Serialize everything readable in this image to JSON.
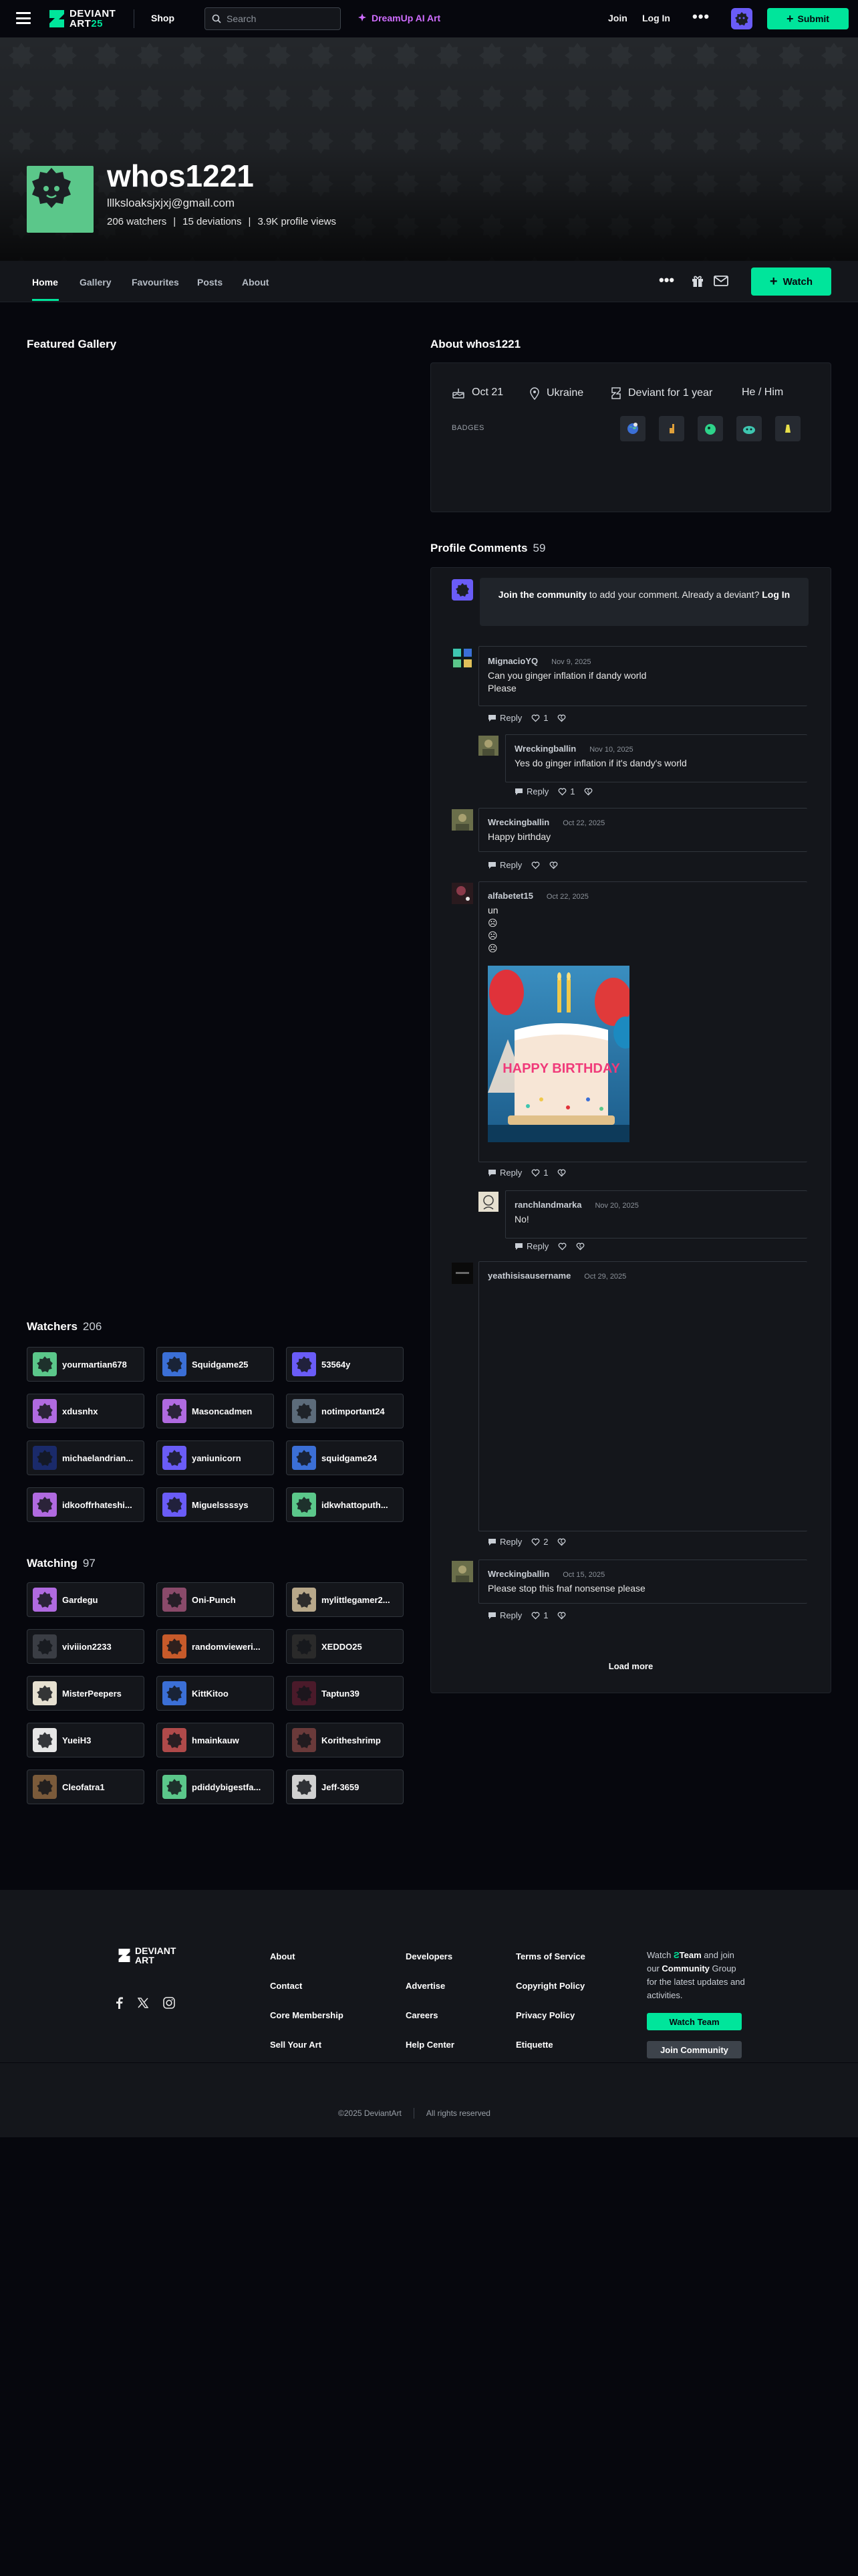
{
  "topbar": {
    "logo_line1": "DEVIANT",
    "logo_line2": "ART",
    "logo_suffix": "25",
    "shop": "Shop",
    "search_placeholder": "Search",
    "dreamup": "DreamUp AI Art",
    "join": "Join",
    "login": "Log In",
    "submit": "Submit"
  },
  "profile": {
    "username": "whos1221",
    "email": "lllksloaksjxjxj@gmail.com",
    "watchers": "206 watchers",
    "deviations": "15 deviations",
    "views": "3.9K profile views",
    "avatar_color": "#5bc78a"
  },
  "nav": {
    "tabs": [
      "Home",
      "Gallery",
      "Favourites",
      "Posts",
      "About"
    ],
    "watch": "Watch"
  },
  "featured": {
    "title": "Featured Gallery"
  },
  "watchers": {
    "title": "Watchers",
    "count": "206",
    "users": [
      {
        "name": "yourmartian678",
        "color": "#5bc78a"
      },
      {
        "name": "Squidgame25",
        "color": "#3b6fd6"
      },
      {
        "name": "53564y",
        "color": "#6a5cf7"
      },
      {
        "name": "xdusnhx",
        "color": "#b06ae0"
      },
      {
        "name": "Masoncadmen",
        "color": "#b06ae0"
      },
      {
        "name": "notimportant24",
        "color": "#5c6b7a"
      },
      {
        "name": "michaelandrian...",
        "color": "#1a2a6a"
      },
      {
        "name": "yaniunicorn",
        "color": "#6a5cf7"
      },
      {
        "name": "squidgame24",
        "color": "#3b6fd6"
      },
      {
        "name": "idkooffrhateshi...",
        "color": "#b06ae0"
      },
      {
        "name": "Miguelssssys",
        "color": "#6a5cf7"
      },
      {
        "name": "idkwhattoputh...",
        "color": "#5bc78a"
      }
    ]
  },
  "watching": {
    "title": "Watching",
    "count": "97",
    "users": [
      {
        "name": "Gardegu",
        "color": "#b06ae0"
      },
      {
        "name": "Oni-Punch",
        "color": "#8a4a6a"
      },
      {
        "name": "mylittlegamer2...",
        "color": "#b8a88a"
      },
      {
        "name": "viviiion2233",
        "color": "#3a3d44"
      },
      {
        "name": "randomvieweri...",
        "color": "#c65a2a"
      },
      {
        "name": "XEDDO25",
        "color": "#2a2a2a"
      },
      {
        "name": "MisterPeepers",
        "color": "#e6e0d0"
      },
      {
        "name": "KittKitoo",
        "color": "#3b6fd6"
      },
      {
        "name": "Taptun39",
        "color": "#4a1a2a"
      },
      {
        "name": "YueiH3",
        "color": "#e6e6e6"
      },
      {
        "name": "hmainkauw",
        "color": "#b04a4a"
      },
      {
        "name": "Koritheshrimp",
        "color": "#6a3a3a"
      },
      {
        "name": "Cleofatra1",
        "color": "#7a5a3a"
      },
      {
        "name": "pdiddybigestfa...",
        "color": "#5bc78a"
      },
      {
        "name": "Jeff-3659",
        "color": "#d0d0d0"
      }
    ]
  },
  "about": {
    "title": "About whos1221",
    "birthday": "Oct 21",
    "location": "Ukraine",
    "member": "Deviant for 1 year",
    "pronouns": "He / Him",
    "badges_label": "BADGES"
  },
  "comments": {
    "title": "Profile Comments",
    "count": "59",
    "join_link": "Join the community",
    "join_text": " to add your comment. Already a deviant? ",
    "login_link": "Log In",
    "reply": "Reply",
    "load_more": "Load more",
    "items": [
      {
        "user": "MignacioYQ",
        "date": "Nov 9, 2025",
        "line1": "Can you ginger inflation if dandy world",
        "line2": "Please",
        "likes": "1"
      },
      {
        "user": "Wreckingballin",
        "date": "Nov 10, 2025",
        "line1": "Yes do ginger inflation if it's dandy's world",
        "likes": "1"
      },
      {
        "user": "Wreckingballin",
        "date": "Oct 22, 2025",
        "line1": "Happy birthday"
      },
      {
        "user": "alfabetet15",
        "date": "Oct 22, 2025",
        "line1": "un",
        "e1": "☹",
        "e2": "☹",
        "e3": "☹",
        "likes": "1"
      },
      {
        "user": "ranchlandmarka",
        "date": "Nov 20, 2025",
        "line1": "No!"
      },
      {
        "user": "yeathisisausername",
        "date": "Oct 29, 2025",
        "likes": "2"
      },
      {
        "user": "Wreckingballin",
        "date": "Oct 15, 2025",
        "line1": "Please stop this fnaf nonsense please",
        "likes": "1"
      }
    ],
    "cake_text": "HAPPY BIRTHDAY"
  },
  "footer": {
    "col1": [
      "About",
      "Contact",
      "Core Membership",
      "Sell Your Art"
    ],
    "col2": [
      "Developers",
      "Advertise",
      "Careers",
      "Help Center"
    ],
    "col3": [
      "Terms of Service",
      "Copyright Policy",
      "Privacy Policy",
      "Etiquette"
    ],
    "promo1": "Watch ",
    "promo_team": "Team",
    "promo2": " and join our ",
    "promo_community": "Community",
    "promo3": " Group for the latest updates and activities.",
    "watch_team": "Watch Team",
    "join_community": "Join Community",
    "copyright": "©2025 DeviantArt",
    "rights": "All rights reserved"
  }
}
